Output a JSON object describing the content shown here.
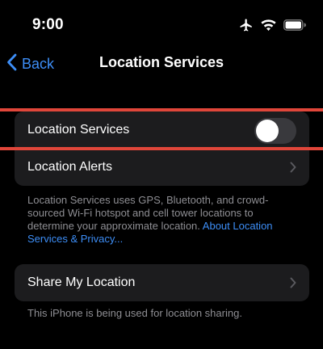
{
  "status_bar": {
    "time": "9:00",
    "icons": [
      "airplane-icon",
      "wifi-icon",
      "battery-icon"
    ]
  },
  "nav": {
    "back_label": "Back",
    "title": "Location Services"
  },
  "group_main": {
    "location_services_label": "Location Services",
    "location_services_on": false,
    "location_alerts_label": "Location Alerts"
  },
  "description": {
    "text": "Location Services uses GPS, Bluetooth, and crowd-sourced Wi-Fi hotspot and cell tower locations to determine your approximate location. ",
    "link": "About Location Services & Privacy..."
  },
  "group_share": {
    "share_label": "Share My Location"
  },
  "share_footnote": "This iPhone is being used for location sharing.",
  "colors": {
    "accent": "#3d8ef7",
    "annotation": "#e0463a",
    "cell": "#1c1c1e",
    "toggle_off": "#39393d"
  }
}
